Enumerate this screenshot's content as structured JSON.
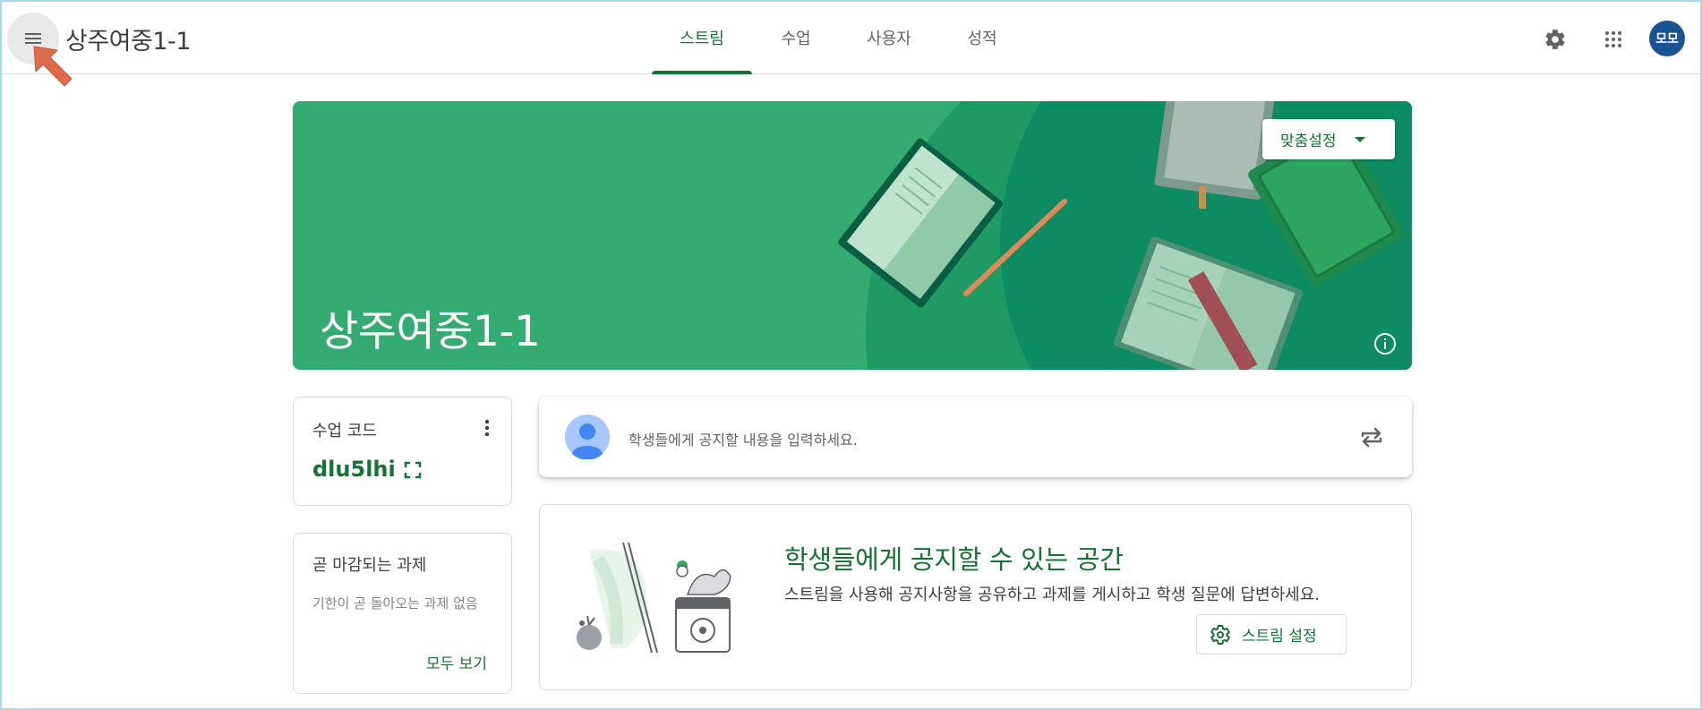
{
  "header": {
    "class_title": "상주여중1-1",
    "tabs": [
      {
        "label": "스트림",
        "active": true
      },
      {
        "label": "수업",
        "active": false
      },
      {
        "label": "사용자",
        "active": false
      },
      {
        "label": "성적",
        "active": false
      }
    ],
    "avatar_initials": "모모",
    "icons": [
      "menu-icon",
      "settings-icon",
      "apps-grid-icon"
    ]
  },
  "banner": {
    "title": "상주여중1-1",
    "customize_label": "맞춤설정",
    "color": "#33ab71"
  },
  "class_code_card": {
    "label": "수업 코드",
    "code": "dlu5lhi"
  },
  "upcoming_card": {
    "title": "곧 마감되는 과제",
    "empty_text": "기한이 곧 돌아오는 과제 없음",
    "view_all_label": "모두 보기"
  },
  "announce": {
    "placeholder": "학생들에게 공지할 내용을 입력하세요."
  },
  "stream_info": {
    "heading": "학생들에게 공지할 수 있는 공간",
    "description": "스트림을 사용해 공지사항을 공유하고 과제를 게시하고 학생 질문에 답변하세요.",
    "settings_button": "스트림 설정"
  },
  "colors": {
    "accent": "#137333",
    "avatar_bg": "#1a5296",
    "cursor_arrow": "#e06b4a"
  }
}
